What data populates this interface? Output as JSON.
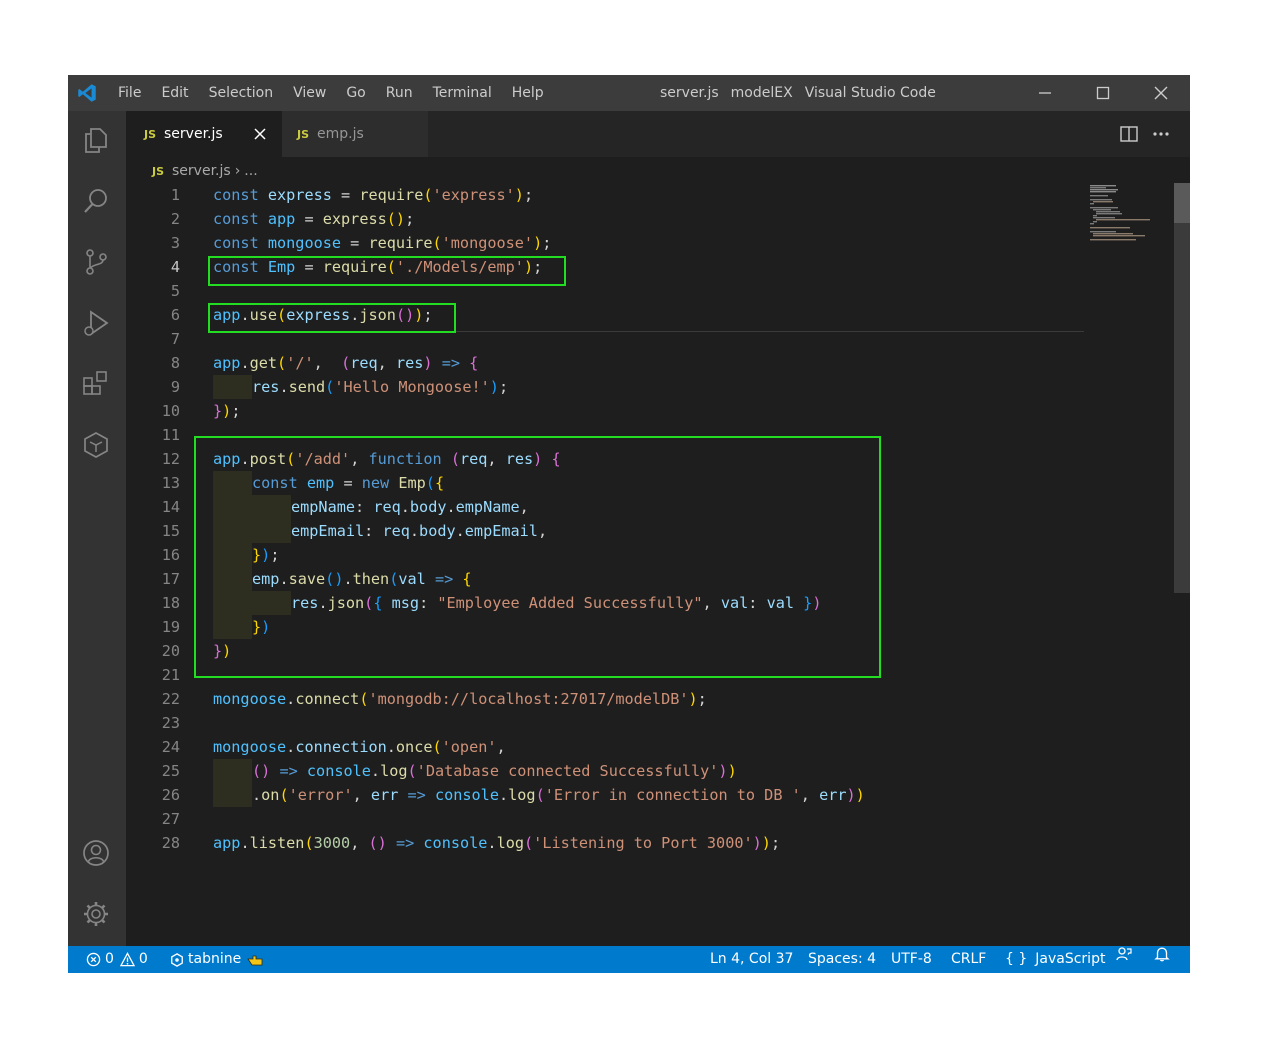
{
  "window": {
    "menu": [
      "File",
      "Edit",
      "Selection",
      "View",
      "Go",
      "Run",
      "Terminal",
      "Help"
    ],
    "title_parts": [
      "server.js",
      "modelEX",
      "Visual Studio Code"
    ]
  },
  "tabs": [
    {
      "label": "server.js",
      "icon": "JS",
      "active": true
    },
    {
      "label": "emp.js",
      "icon": "JS",
      "active": false
    }
  ],
  "breadcrumb": {
    "icon": "JS",
    "file": "server.js",
    "separator": "›",
    "rest": "..."
  },
  "editor": {
    "line_numbers": [
      "1",
      "2",
      "3",
      "4",
      "5",
      "6",
      "7",
      "8",
      "9",
      "10",
      "11",
      "12",
      "13",
      "14",
      "15",
      "16",
      "17",
      "18",
      "19",
      "20",
      "21",
      "22",
      "23",
      "24",
      "25",
      "26",
      "27",
      "28"
    ],
    "current_line": 4,
    "highlight_color": "#22dd22",
    "code_lines": [
      "const express = require('express');",
      "const app = express();",
      "const mongoose = require('mongoose');",
      "const Emp = require('./Models/emp');",
      "",
      "app.use(express.json());",
      "",
      "app.get('/',  (req, res) => {",
      "    res.send('Hello Mongoose!');",
      "});",
      "",
      "app.post('/add', function (req, res) {",
      "    const emp = new Emp({",
      "        empName: req.body.empName,",
      "        empEmail: req.body.empEmail,",
      "    });",
      "    emp.save().then(val => {",
      "        res.json({ msg: \"Employee Added Successfully\", val: val })",
      "    })",
      "})",
      "",
      "mongoose.connect('mongodb://localhost:27017/modelDB');",
      "",
      "mongoose.connection.once('open',",
      "    () => console.log('Database connected Successfully'))",
      "    .on('error', err => console.log('Error in connection to DB ', err))",
      "",
      "app.listen(3000, () => console.log('Listening to Port 3000'));"
    ]
  },
  "status": {
    "errors": "0",
    "warnings": "0",
    "tabnine": "tabnine",
    "position": "Ln 4, Col 37",
    "spaces": "Spaces: 4",
    "encoding": "UTF-8",
    "eol": "CRLF",
    "language_icon": "{ }",
    "language": "JavaScript"
  },
  "colors": {
    "titlebar": "#3c3c3c",
    "activitybar": "#333333",
    "editor": "#1e1e1e",
    "statusbar": "#007acc"
  },
  "icons": [
    "vscode-logo-icon",
    "explorer-icon",
    "search-icon",
    "source-control-icon",
    "run-debug-icon",
    "extensions-icon",
    "remote-explorer-icon",
    "account-icon",
    "settings-gear-icon",
    "minimize-icon",
    "maximize-icon",
    "close-icon",
    "split-editor-icon",
    "more-actions-icon",
    "tab-close-icon",
    "error-icon",
    "warning-icon",
    "tabnine-icon",
    "feedback-icon",
    "bell-icon"
  ]
}
